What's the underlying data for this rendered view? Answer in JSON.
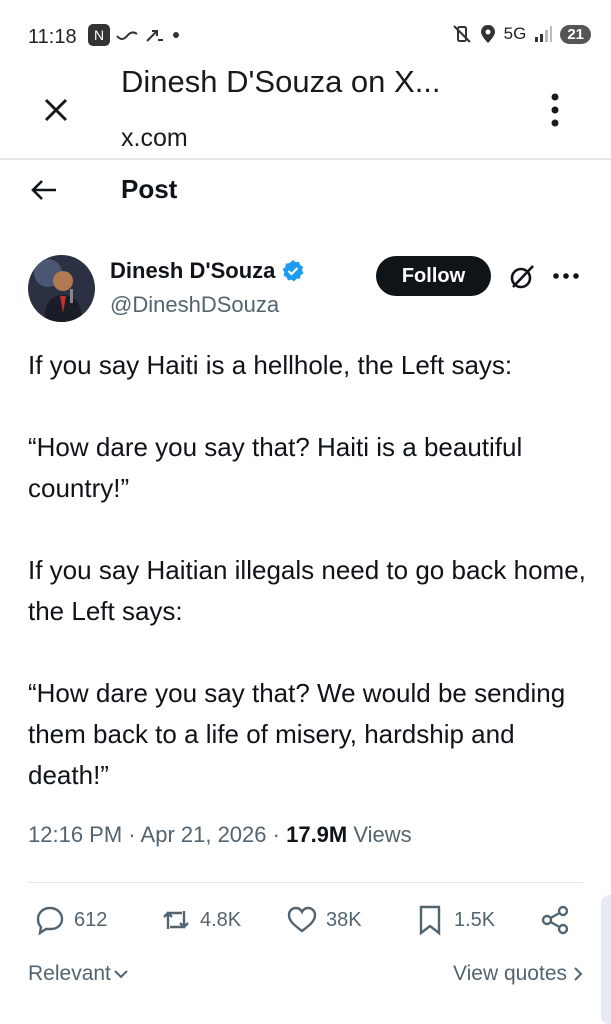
{
  "status_bar": {
    "time": "11:18",
    "network": "5G",
    "battery": "21"
  },
  "tab": {
    "title": "Dinesh D'Souza on X...",
    "url": "x.com"
  },
  "post_header": {
    "title": "Post"
  },
  "author": {
    "name": "Dinesh D'Souza",
    "handle": "@DineshDSouza",
    "follow_label": "Follow"
  },
  "post": {
    "paragraphs": [
      "If you say Haiti is a hellhole, the Left says:",
      "“How dare you say that? Haiti is a beautiful country!”",
      "If you say Haitian illegals need to go back home, the Left says:",
      "“How dare you say that? We would be sending them back to a life of misery, hardship and death!”"
    ],
    "time": "12:16 PM",
    "date": "Apr 21, 2026",
    "views_count": "17.9M",
    "views_label": "Views"
  },
  "actions": {
    "replies": "612",
    "reposts": "4.8K",
    "likes": "38K",
    "bookmarks": "1.5K"
  },
  "footer": {
    "sort_label": "Relevant",
    "view_quotes_label": "View quotes"
  },
  "colors": {
    "verified": "#1d9bf0",
    "text_primary": "#0f1419",
    "text_secondary": "#536471"
  }
}
